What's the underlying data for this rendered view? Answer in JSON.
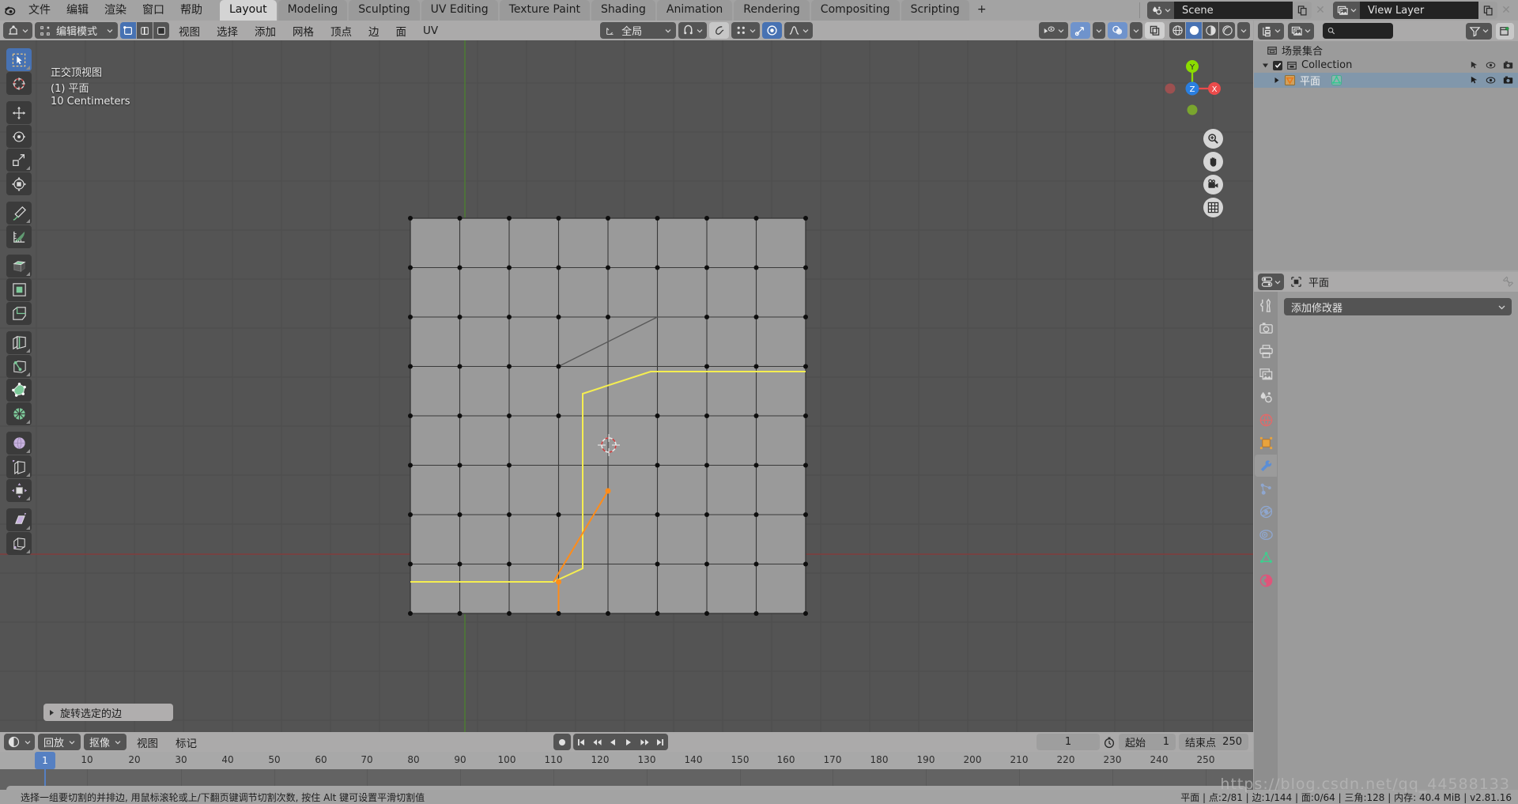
{
  "app": {
    "logo_icon": "blender-logo-icon",
    "menus": [
      "文件",
      "编辑",
      "渲染",
      "窗口",
      "帮助"
    ],
    "workspace_tabs": [
      {
        "label": "Layout",
        "active": true
      },
      {
        "label": "Modeling",
        "active": false
      },
      {
        "label": "Sculpting",
        "active": false
      },
      {
        "label": "UV Editing",
        "active": false
      },
      {
        "label": "Texture Paint",
        "active": false
      },
      {
        "label": "Shading",
        "active": false
      },
      {
        "label": "Animation",
        "active": false
      },
      {
        "label": "Rendering",
        "active": false
      },
      {
        "label": "Compositing",
        "active": false
      },
      {
        "label": "Scripting",
        "active": false
      },
      {
        "label": "+",
        "active": false
      }
    ],
    "scene_name": "Scene",
    "view_layer_name": "View Layer"
  },
  "viewport": {
    "mode": "编辑模式",
    "menus": [
      "视图",
      "选择",
      "添加",
      "网格",
      "顶点",
      "边",
      "面",
      "UV"
    ],
    "transform_orientation": "全局",
    "select_mode": [
      "vertex-select-icon",
      "edge-select-icon",
      "face-select-icon"
    ],
    "select_mode_active": 0,
    "overlay_text": {
      "view_name": "正交顶视图",
      "object_line": "(1) 平面",
      "grid_scale": "10 Centimeters"
    },
    "gizmo_axes": [
      {
        "label": "X",
        "color": "#eb4b4b"
      },
      {
        "label": "Y",
        "color": "#8bdc00"
      },
      {
        "label": "Z",
        "color": "#2a7fe0"
      }
    ],
    "nav_buttons": [
      "zoom-icon",
      "pan-hand-icon",
      "camera-icon",
      "grid-ortho-icon"
    ],
    "operator_panel": "旋转选定的边",
    "shading_modes": [
      "wireframe-shading-icon",
      "solid-shading-icon",
      "material-shading-icon",
      "rendered-shading-icon"
    ],
    "shading_active": 1
  },
  "toolbar": {
    "tools": [
      {
        "name": "tweak-select-box",
        "active": true,
        "group": 0,
        "corner": true
      },
      {
        "name": "cursor-3d",
        "active": false,
        "group": 0,
        "corner": false
      },
      {
        "name": "move",
        "active": false,
        "group": 1,
        "corner": false
      },
      {
        "name": "rotate",
        "active": false,
        "group": 1,
        "corner": false
      },
      {
        "name": "scale",
        "active": false,
        "group": 1,
        "corner": true
      },
      {
        "name": "transform",
        "active": false,
        "group": 1,
        "corner": false
      },
      {
        "name": "annotate",
        "active": false,
        "group": 2,
        "corner": true
      },
      {
        "name": "measure",
        "active": false,
        "group": 2,
        "corner": false
      },
      {
        "name": "extrude-region",
        "active": false,
        "group": 3,
        "corner": true
      },
      {
        "name": "inset-faces",
        "active": false,
        "group": 3,
        "corner": false
      },
      {
        "name": "bevel",
        "active": false,
        "group": 3,
        "corner": false
      },
      {
        "name": "loop-cut",
        "active": false,
        "group": 4,
        "corner": true
      },
      {
        "name": "knife",
        "active": false,
        "group": 4,
        "corner": true
      },
      {
        "name": "poly-build",
        "active": false,
        "group": 4,
        "corner": false
      },
      {
        "name": "spin",
        "active": false,
        "group": 4,
        "corner": true
      },
      {
        "name": "smooth",
        "active": false,
        "group": 5,
        "corner": true
      },
      {
        "name": "edge-slide",
        "active": false,
        "group": 5,
        "corner": true
      },
      {
        "name": "shrink-fatten",
        "active": false,
        "group": 5,
        "corner": true
      },
      {
        "name": "shear",
        "active": false,
        "group": 6,
        "corner": true
      },
      {
        "name": "rip-region",
        "active": false,
        "group": 6,
        "corner": true
      }
    ]
  },
  "outliner": {
    "search_placeholder": "",
    "display_mode_icon": "outliner-view-layer-icon",
    "filter_icon": "filter-icon",
    "new_collection_icon": "new-collection-icon",
    "rows": [
      {
        "label": "场景集合",
        "indent": 0,
        "icon": "scene-collection-icon",
        "selected": false,
        "checkbox": false,
        "expander": false,
        "controls": false
      },
      {
        "label": "Collection",
        "indent": 1,
        "icon": "collection-icon",
        "selected": false,
        "checkbox": true,
        "expander": true,
        "controls": true
      },
      {
        "label": "平面",
        "indent": 2,
        "icon": "mesh-object-icon",
        "selected": true,
        "checkbox": false,
        "expander": true,
        "controls": true,
        "extra_icon": "mesh-data-icon"
      }
    ]
  },
  "properties": {
    "breadcrumb_object": "平面",
    "editor_icon": "properties-editor-icon",
    "pin_icon": "pin-icon",
    "add_modifier_label": "添加修改器",
    "tabs": [
      {
        "name": "tool-tab",
        "active": false,
        "color": "#d8d8d8"
      },
      {
        "name": "render-tab",
        "active": false,
        "color": "#d8d8d8"
      },
      {
        "name": "output-tab",
        "active": false,
        "color": "#d8d8d8"
      },
      {
        "name": "view-layer-tab",
        "active": false,
        "color": "#d8d8d8"
      },
      {
        "name": "scene-tab",
        "active": false,
        "color": "#d8d8d8"
      },
      {
        "name": "world-tab",
        "active": false,
        "color": "#e06a6a"
      },
      {
        "name": "object-tab",
        "active": false,
        "color": "#e8a33d"
      },
      {
        "name": "modifier-tab",
        "active": true,
        "color": "#5b8ed6"
      },
      {
        "name": "particles-tab",
        "active": false,
        "color": "#8fa7d0"
      },
      {
        "name": "physics-tab",
        "active": false,
        "color": "#8fa7d0"
      },
      {
        "name": "constraints-tab",
        "active": false,
        "color": "#8fa7d0"
      },
      {
        "name": "object-data-tab",
        "active": false,
        "color": "#3ecf8e"
      },
      {
        "name": "material-tab",
        "active": false,
        "color": "#e0547a"
      }
    ]
  },
  "timeline": {
    "editor_icon": "timeline-editor-icon",
    "dropdowns": [
      "回放",
      "抠像"
    ],
    "menus": [
      "视图",
      "标记"
    ],
    "current_frame": "1",
    "start_label": "起始",
    "start_value": "1",
    "end_label": "结束点",
    "end_value": "250",
    "ticks": [
      1,
      10,
      20,
      30,
      40,
      50,
      60,
      70,
      80,
      90,
      100,
      110,
      120,
      130,
      140,
      150,
      160,
      170,
      180,
      190,
      200,
      210,
      220,
      230,
      240,
      250
    ],
    "transport_icons": [
      "jump-start-icon",
      "prev-keyframe-icon",
      "play-reverse-icon",
      "play-icon",
      "next-keyframe-icon",
      "jump-end-icon"
    ],
    "record_icon": "auto-keying-icon",
    "timer_icon": "use-preview-range-icon"
  },
  "statusbar": {
    "hint": "选择一组要切割的并排边, 用鼠标滚轮或上/下翻页键调节切割次数, 按住 Alt 键可设置平滑切割值",
    "stats": "平面 | 点:2/81 | 边:1/144 | 面:0/64 | 三角:128  | 内存: 40.4 MiB | v2.81.16",
    "watermark": "https://blog.csdn.net/qq_44588133"
  },
  "colors": {
    "accent_blue": "#4772b3",
    "selected_edge_yellow": "#f5ee50",
    "active_orange": "#ff8c19",
    "axis_x_red": "#c94a4a",
    "axis_y_green": "#5a8a32"
  }
}
